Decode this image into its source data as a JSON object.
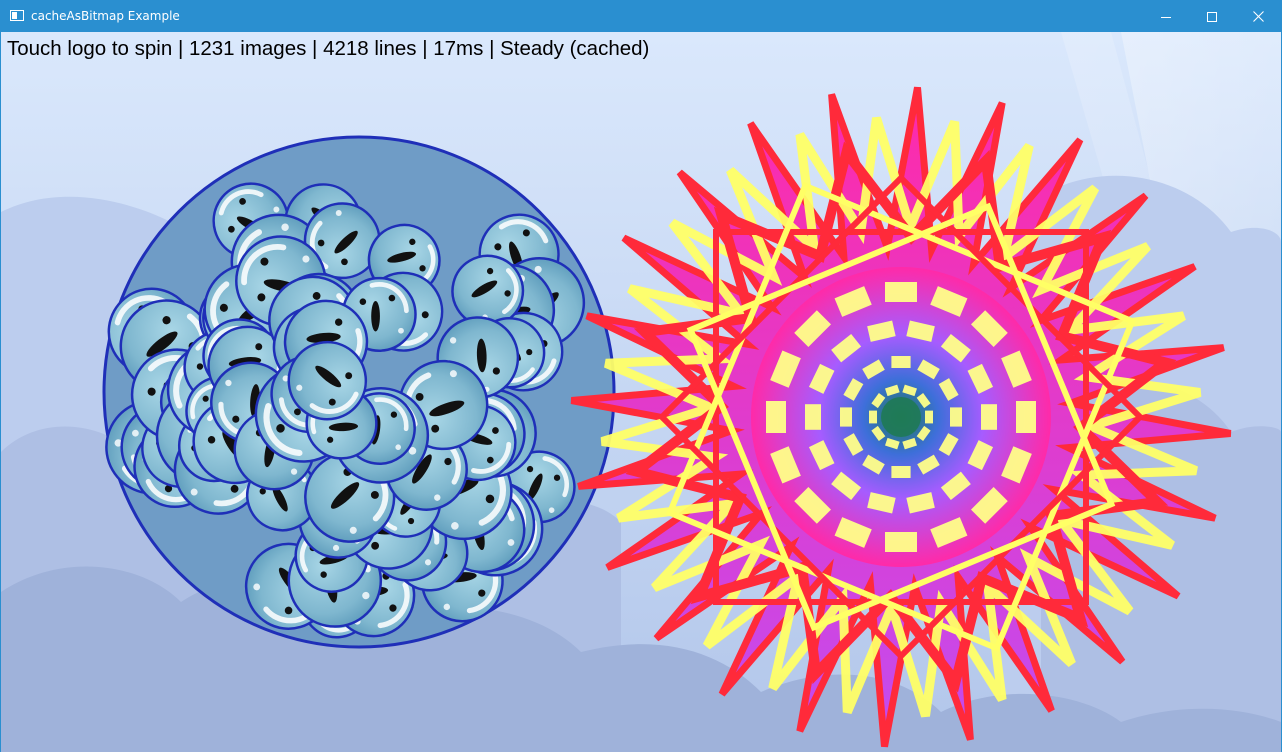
{
  "window": {
    "title": "cacheAsBitmap Example",
    "controls": {
      "minimize": "minimize-icon",
      "maximize": "maximize-icon",
      "close": "close-icon"
    }
  },
  "status": {
    "text": "Touch logo to spin | 1231 images | 4218 lines | 17ms | Steady (cached)"
  },
  "colors": {
    "titlebar": "#2a8fd0",
    "sky_top": "#d8e6fb",
    "sky_bottom": "#b4c8ec",
    "cloud_back": "#b9cbec",
    "cloud_front": "#9fb2da",
    "bubble_fill": "#7fb7cf",
    "bubble_outline": "#1f2fb8",
    "star_magenta": "#ff2aa8",
    "star_red": "#ff2a3a",
    "star_yellow": "#ffff66",
    "star_violet": "#a65cff",
    "star_center": "#1f7a55"
  }
}
